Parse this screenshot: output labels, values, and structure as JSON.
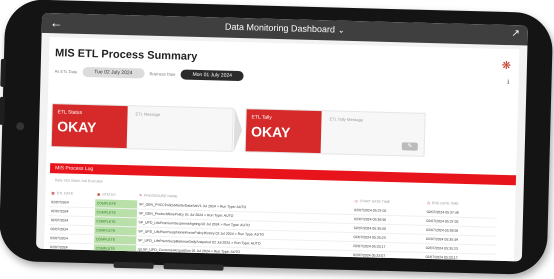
{
  "header": {
    "back_icon": "arrow-left-icon",
    "title": "Data Monitoring Dashboard",
    "dropdown_icon": "chevron-down-icon",
    "expand_icon": "expand-icon"
  },
  "page": {
    "title": "MIS ETL Process Summary",
    "etl_date_label": "As ETL Date",
    "etl_date": "Tue 02 July 2024",
    "business_date_label": "Business Date",
    "business_date": "Mon 01 July 2024"
  },
  "etl_status": {
    "label": "ETL Status",
    "value": "OKAY",
    "message_label": "ETL Message"
  },
  "etl_tally": {
    "label": "ETL Tally",
    "value": "OKAY",
    "message_label": "ETL Tally Message"
  },
  "log": {
    "title": "MIS Process Log",
    "note": "Daily SQL Batch Job Execution",
    "columns": [
      "ETL DATE",
      "STATUS",
      "PROCEDURE NAME",
      "START DATE TIME",
      "END DATE TIME"
    ],
    "rows": [
      [
        "02/07/2024",
        "COMPLETE",
        "SP_GEN_PSCCPolicyMasterDataSetV1 Jul 2024 > Run Type: AUTO",
        "02/07/2024 05:37:02",
        "02/07/2024 05:37:49"
      ],
      [
        "02/07/2024",
        "COMPLETE",
        "SP_GEN_ProductWisePolicy 01 Jul 2024 > Run Type: AUTO",
        "02/07/2024 05:36:56",
        "02/07/2024 05:37:02"
      ],
      [
        "02/07/2024",
        "COMPLETE",
        "SP_UPD_LifePremiumSuspenseAgeing 02 Jul 2024 > Run Type: AUTO",
        "02/07/2024 05:35:50",
        "02/07/2024 05:36:56"
      ],
      [
        "02/07/2024",
        "COMPLETE",
        "SP_UPD_LifePremSuspNonInForcePolicyHistory 02 Jul 2024 > Run Type: AUTO",
        "02/07/2024 05:35:23",
        "02/07/2024 05:35:49"
      ],
      [
        "02/07/2024",
        "COMPLETE",
        "SP_UPD_LifePremSuspBalanceDailySnapshot 02 Jul 2024 > Run Type: AUTO",
        "02/07/2024 05:33:17",
        "02/07/2024 05:35:23"
      ],
      [
        "02/07/2024",
        "COMPLETE",
        "rpt.SP_UPD_CustomerAcquisition 01 Jul 2024 > Run Type: AUTO",
        "02/07/2024 05:33:07",
        "02/07/2024 05:33:17"
      ]
    ]
  },
  "colors": {
    "accent": "#e8141b",
    "okay_box": "#d62a2a",
    "complete": "#b8e0a8",
    "topbar": "#3f3f3f"
  }
}
